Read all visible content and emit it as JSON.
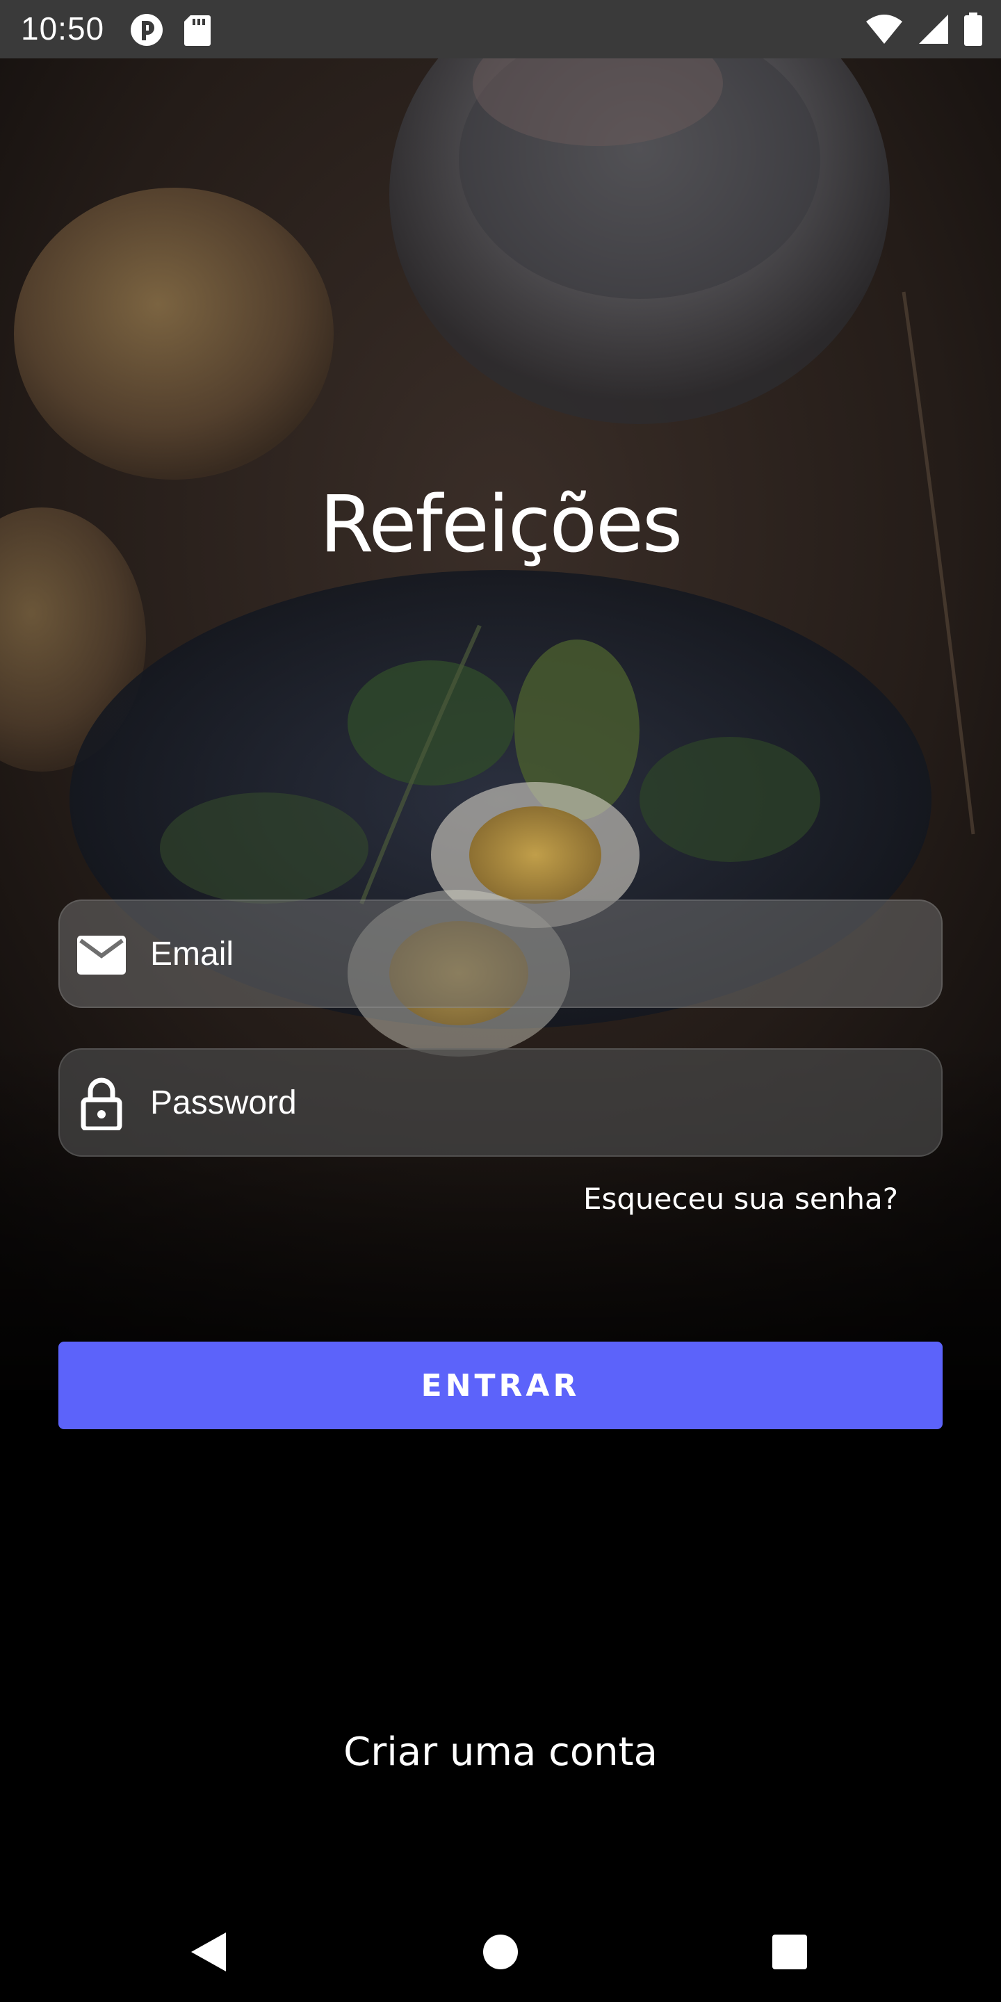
{
  "status_bar": {
    "time": "10:50",
    "left_icons": [
      "app-notification-icon",
      "sd-card-icon"
    ],
    "right_icons": [
      "wifi-icon",
      "cellular-signal-icon",
      "battery-icon"
    ]
  },
  "app": {
    "title": "Refeições"
  },
  "form": {
    "email": {
      "placeholder": "Email",
      "value": "",
      "icon": "envelope-icon"
    },
    "password": {
      "placeholder": "Password",
      "value": "",
      "icon": "lock-icon"
    },
    "forgot_password_label": "Esqueceu sua senha?",
    "submit_label": "ENTRAR",
    "create_account_label": "Criar uma conta"
  },
  "colors": {
    "accent": "#5c63fa",
    "status_bar": "#3a3a3a",
    "text": "#ffffff",
    "background": "#000000"
  },
  "nav_bar": {
    "buttons": [
      "back-icon",
      "home-icon",
      "recents-icon"
    ]
  }
}
